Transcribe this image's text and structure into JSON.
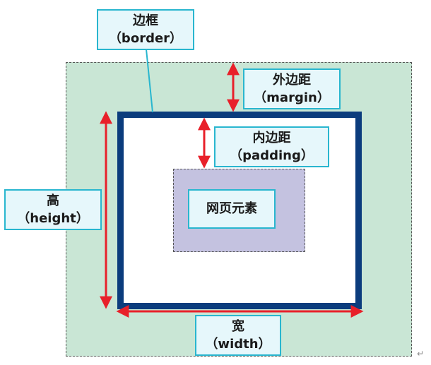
{
  "labels": {
    "border": {
      "cn": "边框",
      "en": "（border）"
    },
    "margin": {
      "cn": "外边距",
      "en": "（margin）"
    },
    "padding": {
      "cn": "内边距",
      "en": "（padding）"
    },
    "content": {
      "cn": "网页元素"
    },
    "height": {
      "cn": "高",
      "en": "（height）"
    },
    "width": {
      "cn": "宽",
      "en": "（width）"
    }
  },
  "colors": {
    "margin_fill": "#c9e6d5",
    "border_color": "#0b3c7d",
    "content_fill": "#c4c2e0",
    "arrow_color": "#e8202a",
    "label_border": "#29b6cf",
    "label_fill": "#e6f7fb"
  },
  "return_mark": "↵"
}
